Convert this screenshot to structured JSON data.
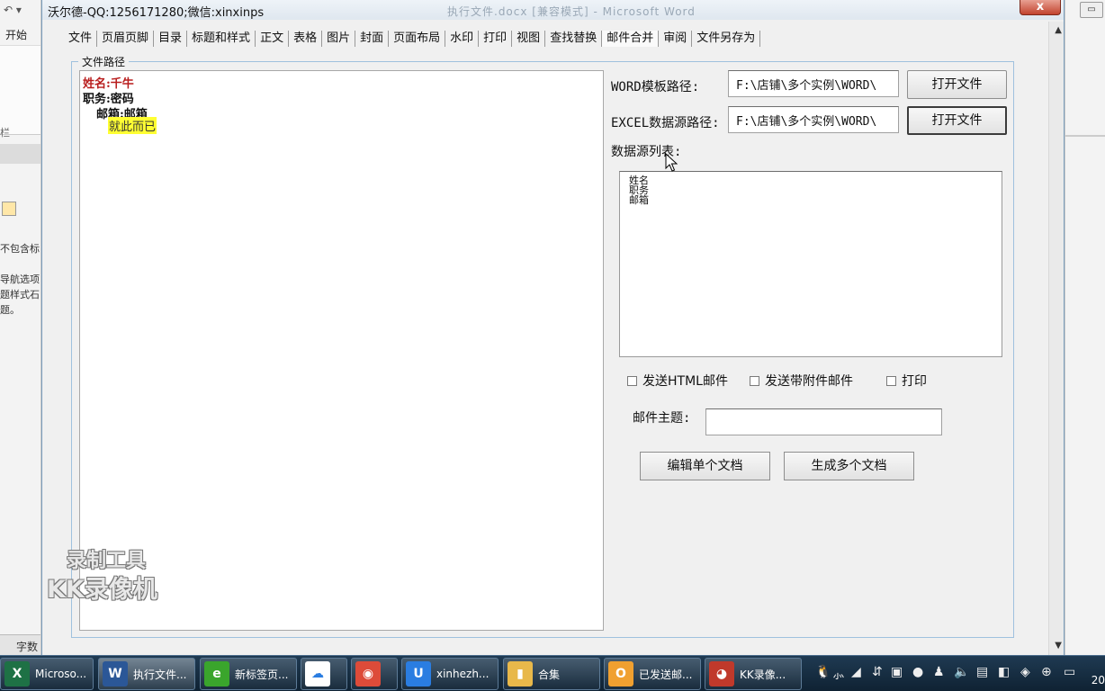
{
  "window": {
    "title": "沃尔德-QQ:1256171280;微信:xinxinps",
    "title_faded": "执行文件.docx [兼容模式] - Microsoft Word",
    "close_label": "x"
  },
  "menu": [
    "文件",
    "页眉页脚",
    "目录",
    "标题和样式",
    "正文",
    "表格",
    "图片",
    "封面",
    "页面布局",
    "水印",
    "打印",
    "视图",
    "查找替换",
    "邮件合并",
    "审阅",
    "文件另存为"
  ],
  "group_label": "文件路径",
  "editor": {
    "line1": "姓名:千牛",
    "line2": "职务:密码",
    "line3": "邮箱:邮箱",
    "line4": "就此而已"
  },
  "word_template": {
    "label": "WORD模板路径:",
    "value": "F:\\店铺\\多个实例\\WORD\\",
    "button": "打开文件"
  },
  "excel_source": {
    "label": "EXCEL数据源路径:",
    "value": "F:\\店铺\\多个实例\\WORD\\",
    "button": "打开文件"
  },
  "datasource": {
    "label": "数据源列表:",
    "items": [
      "姓名",
      "职务",
      "邮箱"
    ]
  },
  "options": {
    "html_mail": {
      "label": "发送HTML邮件",
      "checked": false
    },
    "attach_mail": {
      "label": "发送带附件邮件",
      "checked": false
    },
    "print": {
      "label": "打印",
      "checked": false
    }
  },
  "subject": {
    "label": "邮件主题:",
    "value": ""
  },
  "actions": {
    "edit_single": "编辑单个文档",
    "generate_multi": "生成多个文档"
  },
  "watermark": {
    "line1": "录制工具",
    "line2": "KK录像机"
  },
  "background_word": {
    "ribbon_tab": "开始",
    "nav_text_1": "不包含标",
    "nav_text_2": "导航选项",
    "nav_text_3": "题样式石",
    "nav_text_4": "题。",
    "status_word": "字数"
  },
  "taskbar": {
    "items": [
      {
        "label": "Microso...",
        "icon": "excel-icon",
        "color": "#1e7145"
      },
      {
        "label": "执行文件...",
        "icon": "word-icon",
        "color": "#2b5797",
        "active": true
      },
      {
        "label": "新标签页...",
        "icon": "browser-360-icon",
        "color": "#3aa52c"
      },
      {
        "label": "",
        "icon": "baidu-cloud-icon",
        "color": "#ffffff"
      },
      {
        "label": "",
        "icon": "chrome-icon",
        "color": "#dd4b39"
      },
      {
        "label": "xinhezh...",
        "icon": "qq-mail-icon",
        "color": "#2a7de1"
      },
      {
        "label": "合集",
        "icon": "folder-icon",
        "color": "#e8b84a"
      },
      {
        "label": "已发送邮...",
        "icon": "outlook-icon",
        "color": "#f0a030"
      },
      {
        "label": "KK录像...",
        "icon": "kk-recorder-icon",
        "color": "#c0392b"
      }
    ],
    "clock": "20"
  }
}
